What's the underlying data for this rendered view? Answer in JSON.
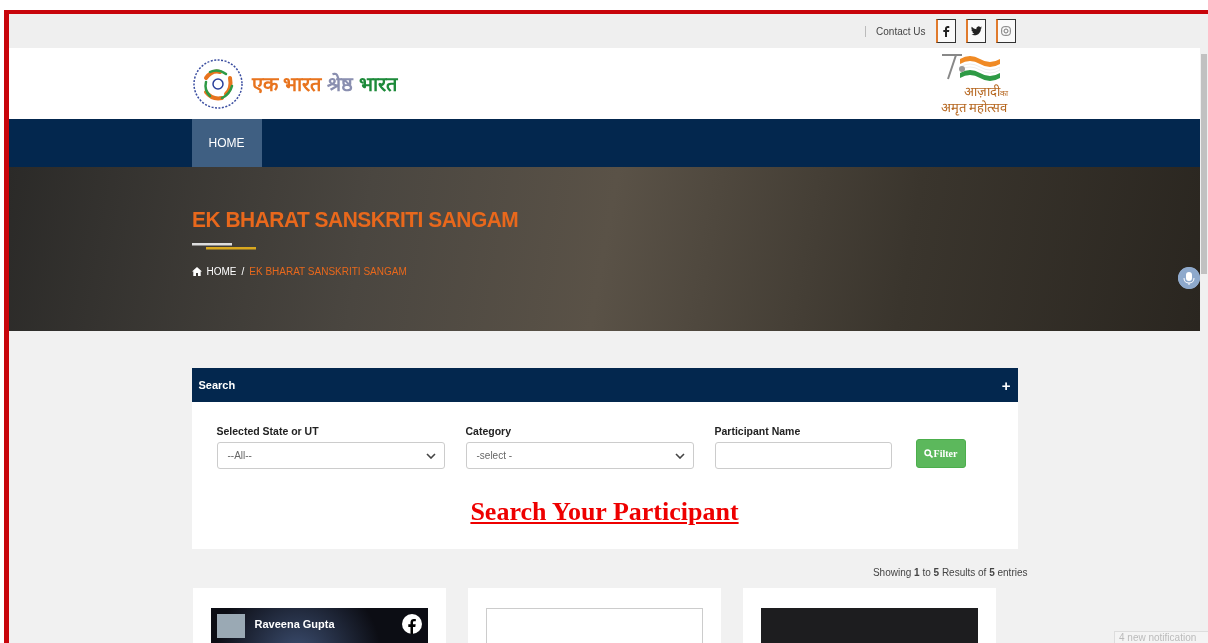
{
  "top_bar": {
    "contact_link": "Contact Us",
    "social": [
      {
        "kind": "facebook"
      },
      {
        "kind": "twitter"
      },
      {
        "kind": "instagram"
      }
    ]
  },
  "header": {
    "logo_words": [
      {
        "text": "एक भारत",
        "color": "#e8741e"
      },
      {
        "text": "श्रेष्ठ",
        "color": "#8a8fb0"
      },
      {
        "text": "भारत",
        "color": "#1d8a3a"
      }
    ],
    "emblem_lines": [
      "आज़ादी",
      "का",
      "अमृत महोत्सव"
    ]
  },
  "nav": [
    {
      "label": "HOME",
      "selected": true
    }
  ],
  "hero": {
    "title": "EK BHARAT SANSKRITI SANGAM",
    "breadcrumb": [
      {
        "label": "HOME",
        "selected": false
      },
      {
        "label": "EK BHARAT SANSKRITI SANGAM",
        "selected": true
      }
    ],
    "separator": "/"
  },
  "search_panel": {
    "title": "Search",
    "toggle": "+",
    "fields": [
      {
        "kind": "select",
        "label": "Selected State or UT",
        "value": "--All--"
      },
      {
        "kind": "select",
        "label": "Category",
        "value": "-select -"
      },
      {
        "kind": "text",
        "label": "Participant Name"
      }
    ],
    "filter_button": "Filter",
    "heading": "Search Your Participant"
  },
  "results": {
    "summary": "Showing **1** to **5** Results of **5** entries",
    "cards": [
      {
        "kind": "video",
        "title": "Raveena Gupta"
      },
      {
        "kind": "blank"
      },
      {
        "kind": "dark"
      }
    ]
  },
  "notification": "4 new notification"
}
